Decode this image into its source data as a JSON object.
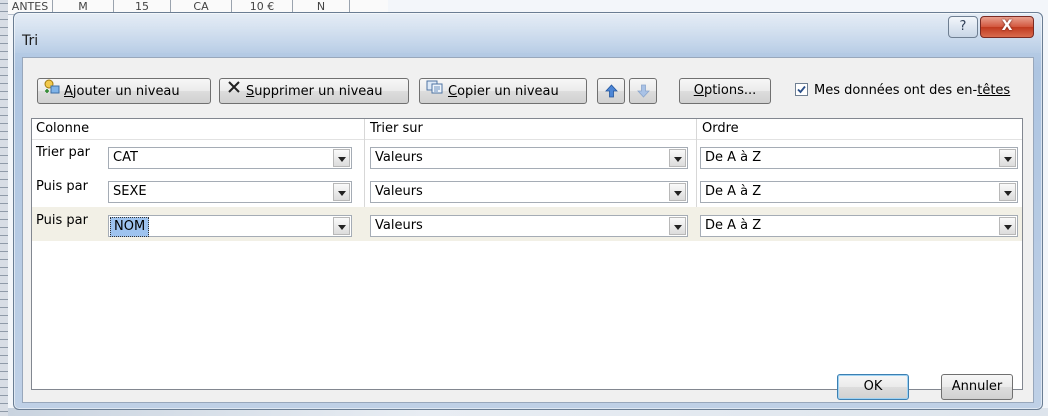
{
  "background_sheet": {
    "cells": [
      "ANTES",
      "M",
      "15",
      "CA",
      "10 €",
      "N"
    ]
  },
  "dialog": {
    "title": "Tri",
    "help_glyph": "?",
    "close_glyph": "X"
  },
  "toolbar": {
    "add_level": {
      "mnemonic": "A",
      "rest": "jouter un niveau"
    },
    "delete_level": {
      "mnemonic": "S",
      "rest": "upprimer un niveau"
    },
    "copy_level": {
      "mnemonic": "C",
      "rest": "opier un niveau"
    },
    "move_up_icon": "arrow-up-icon",
    "move_down_icon": "arrow-down-icon",
    "options": {
      "mnemonic": "O",
      "rest": "ptions..."
    },
    "headers_checkbox": {
      "checked": true,
      "label_prefix": "Mes données ont des en-",
      "label_underlined": "têtes"
    }
  },
  "grid": {
    "headers": {
      "column": "Colonne",
      "sort_on": "Trier sur",
      "order": "Ordre"
    },
    "rows": [
      {
        "label": "Trier par",
        "column": "CAT",
        "sort_on": "Valeurs",
        "order": "De A à Z",
        "selected": false
      },
      {
        "label": "Puis par",
        "column": "SEXE",
        "sort_on": "Valeurs",
        "order": "De A à Z",
        "selected": false
      },
      {
        "label": "Puis par",
        "column": "NOM",
        "sort_on": "Valeurs",
        "order": "De A à Z",
        "selected": true
      }
    ]
  },
  "footer": {
    "ok": "OK",
    "cancel": "Annuler"
  },
  "colors": {
    "selection_highlight": "#9ec3ef",
    "selected_row": "#f2f0e6",
    "close_button": "#c0391f",
    "title_bar": "#b8cde6"
  }
}
